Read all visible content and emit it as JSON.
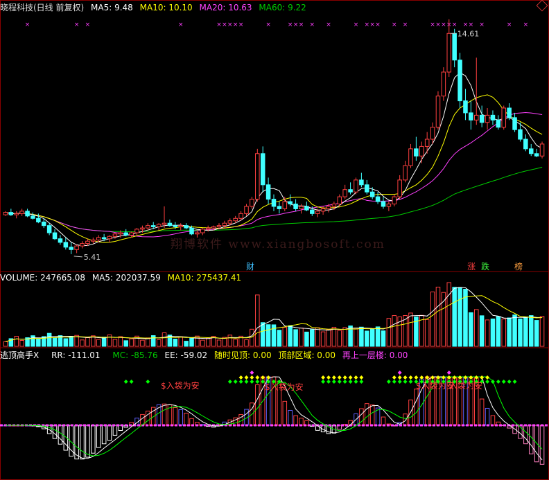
{
  "colors": {
    "bg": "#000000",
    "up": "#ff4040",
    "down": "#40ffff",
    "ma5": "#ffffff",
    "ma10": "#ffff00",
    "ma20": "#ff40ff",
    "ma60": "#00cc00",
    "grid": "#8b0000",
    "magenta_marker": "#ff40ff",
    "green_diamond": "#00ff00",
    "yellow_diamond": "#ffff00",
    "bar_blue": "#6060ff",
    "bar_pink": "#ff80c0",
    "bar_white": "#ffffff"
  },
  "price_panel": {
    "title": "晓程科技(日线 前复权)",
    "ma5": "MA5: 9.48",
    "ma10": "MA10: 10.10",
    "ma20": "MA20: 10.63",
    "ma60": "MA60: 9.22",
    "high_label": "14.61",
    "low_label": "5.41",
    "badges": [
      {
        "text": "财",
        "color": "#40c0ff"
      },
      {
        "text": "涨",
        "color": "#ff4040"
      },
      {
        "text": "跌",
        "color": "#40ff40"
      },
      {
        "text": "榜",
        "color": "#ffa040"
      }
    ]
  },
  "volume_panel": {
    "volume": "VOLUME: 247665.08",
    "ma5": "MA5: 202037.59",
    "ma10": "MA10: 275437.41"
  },
  "indicator_panel": {
    "name": "逃顶高手X",
    "rr": "RR: -111.01",
    "mc": "MC: -85.76",
    "ee": "EE: -59.02",
    "t1": "随时见顶: 0.00",
    "t2": "顶部区域: 0.00",
    "t3": "再上一层楼: 0.00",
    "signals": [
      "$入袋为安",
      "$入袋为安",
      "$入袋为安",
      "入袋为安"
    ]
  },
  "watermark": "翔博软件 www.xiangbosoft.com",
  "chart_data": {
    "type": "candlestick",
    "ylim": [
      4.8,
      15.6
    ],
    "annotations": [
      "14.61",
      "5.41"
    ],
    "candles": [
      [
        7.05,
        7.2,
        7.0,
        7.15
      ],
      [
        7.15,
        7.3,
        7.0,
        7.05
      ],
      [
        7.05,
        7.2,
        6.9,
        7.1
      ],
      [
        7.1,
        7.3,
        7.0,
        7.2
      ],
      [
        7.2,
        7.3,
        6.95,
        7.0
      ],
      [
        7.0,
        7.15,
        6.85,
        6.9
      ],
      [
        6.9,
        7.1,
        6.7,
        6.75
      ],
      [
        6.75,
        6.9,
        6.5,
        6.6
      ],
      [
        6.6,
        6.7,
        6.2,
        6.3
      ],
      [
        6.3,
        6.45,
        6.0,
        6.05
      ],
      [
        6.05,
        6.2,
        5.8,
        5.9
      ],
      [
        5.9,
        6.1,
        5.6,
        5.7
      ],
      [
        5.7,
        5.9,
        5.41,
        5.6
      ],
      [
        5.6,
        5.8,
        5.45,
        5.75
      ],
      [
        5.75,
        5.95,
        5.65,
        5.85
      ],
      [
        5.85,
        6.05,
        5.75,
        5.95
      ],
      [
        5.95,
        6.1,
        5.85,
        6.0
      ],
      [
        6.0,
        6.2,
        5.9,
        6.1
      ],
      [
        6.1,
        6.25,
        5.95,
        6.05
      ],
      [
        6.05,
        6.2,
        5.9,
        6.15
      ],
      [
        6.15,
        6.3,
        6.05,
        6.25
      ],
      [
        6.25,
        6.4,
        6.1,
        6.3
      ],
      [
        6.3,
        6.45,
        6.15,
        6.2
      ],
      [
        6.2,
        6.35,
        6.1,
        6.3
      ],
      [
        6.3,
        6.5,
        6.2,
        6.45
      ],
      [
        6.45,
        6.6,
        6.3,
        6.5
      ],
      [
        6.5,
        6.7,
        6.4,
        6.6
      ],
      [
        6.6,
        6.75,
        6.45,
        6.55
      ],
      [
        6.55,
        6.7,
        6.4,
        6.65
      ],
      [
        6.65,
        7.4,
        6.5,
        6.7
      ],
      [
        6.7,
        6.85,
        6.55,
        6.6
      ],
      [
        6.6,
        6.75,
        6.45,
        6.55
      ],
      [
        6.55,
        6.7,
        6.4,
        6.6
      ],
      [
        6.6,
        6.7,
        6.45,
        6.5
      ],
      [
        6.5,
        6.6,
        6.2,
        6.25
      ],
      [
        6.25,
        6.4,
        6.1,
        6.3
      ],
      [
        6.3,
        6.5,
        6.2,
        6.45
      ],
      [
        6.45,
        6.6,
        6.35,
        6.5
      ],
      [
        6.5,
        6.6,
        6.4,
        6.55
      ],
      [
        6.55,
        6.7,
        6.45,
        6.6
      ],
      [
        6.6,
        6.8,
        6.5,
        6.7
      ],
      [
        6.7,
        6.9,
        6.6,
        6.8
      ],
      [
        6.8,
        7.0,
        6.7,
        6.9
      ],
      [
        6.9,
        7.2,
        6.8,
        7.1
      ],
      [
        7.1,
        7.5,
        7.0,
        7.4
      ],
      [
        7.4,
        7.8,
        7.3,
        7.7
      ],
      [
        7.7,
        9.8,
        7.6,
        9.6
      ],
      [
        9.6,
        9.9,
        8.0,
        8.3
      ],
      [
        8.3,
        8.6,
        7.5,
        7.7
      ],
      [
        7.7,
        7.9,
        7.2,
        7.4
      ],
      [
        7.4,
        7.6,
        7.1,
        7.3
      ],
      [
        7.3,
        7.8,
        7.2,
        7.6
      ],
      [
        7.6,
        7.9,
        7.4,
        7.5
      ],
      [
        7.5,
        7.7,
        7.2,
        7.3
      ],
      [
        7.3,
        7.5,
        7.1,
        7.4
      ],
      [
        7.4,
        7.6,
        7.2,
        7.25
      ],
      [
        7.25,
        7.4,
        7.0,
        7.1
      ],
      [
        7.1,
        7.3,
        6.95,
        7.2
      ],
      [
        7.2,
        7.4,
        7.05,
        7.3
      ],
      [
        7.3,
        7.5,
        7.15,
        7.4
      ],
      [
        7.4,
        7.6,
        7.25,
        7.5
      ],
      [
        7.5,
        7.9,
        7.4,
        7.8
      ],
      [
        7.8,
        8.3,
        7.7,
        8.1
      ],
      [
        8.1,
        8.4,
        7.9,
        8.0
      ],
      [
        8.0,
        8.6,
        7.9,
        8.5
      ],
      [
        8.5,
        8.8,
        8.2,
        8.3
      ],
      [
        8.3,
        8.5,
        7.9,
        8.0
      ],
      [
        8.0,
        8.2,
        7.7,
        7.8
      ],
      [
        7.8,
        8.0,
        7.5,
        7.6
      ],
      [
        7.6,
        7.8,
        7.3,
        7.4
      ],
      [
        7.4,
        7.6,
        7.2,
        7.5
      ],
      [
        7.5,
        7.9,
        7.4,
        7.8
      ],
      [
        7.8,
        8.7,
        7.7,
        8.5
      ],
      [
        8.5,
        9.3,
        8.4,
        9.1
      ],
      [
        9.1,
        10.0,
        9.0,
        9.8
      ],
      [
        9.8,
        10.3,
        9.3,
        9.5
      ],
      [
        9.5,
        10.1,
        9.2,
        9.9
      ],
      [
        9.9,
        10.5,
        9.6,
        10.2
      ],
      [
        10.2,
        10.9,
        10.0,
        10.7
      ],
      [
        10.7,
        12.2,
        10.6,
        12.0
      ],
      [
        12.0,
        13.2,
        11.8,
        13.0
      ],
      [
        13.0,
        15.2,
        12.8,
        14.61
      ],
      [
        14.61,
        14.8,
        13.2,
        13.5
      ],
      [
        13.5,
        13.8,
        11.5,
        11.8
      ],
      [
        11.8,
        12.3,
        11.0,
        11.3
      ],
      [
        11.3,
        11.8,
        10.6,
        11.0
      ],
      [
        11.0,
        13.6,
        10.8,
        11.2
      ],
      [
        11.2,
        11.6,
        10.7,
        10.9
      ],
      [
        10.9,
        11.5,
        10.6,
        11.2
      ],
      [
        11.2,
        11.4,
        10.8,
        11.0
      ],
      [
        11.0,
        11.2,
        10.6,
        10.7
      ],
      [
        10.7,
        11.6,
        10.6,
        11.5
      ],
      [
        11.5,
        11.7,
        11.0,
        11.1
      ],
      [
        11.1,
        11.3,
        10.5,
        10.6
      ],
      [
        10.6,
        10.9,
        10.1,
        10.2
      ],
      [
        10.2,
        10.4,
        9.7,
        9.8
      ],
      [
        9.8,
        10.0,
        9.5,
        9.6
      ],
      [
        9.6,
        9.8,
        9.45,
        9.5
      ],
      [
        9.5,
        10.1,
        9.4,
        10.0
      ]
    ]
  }
}
